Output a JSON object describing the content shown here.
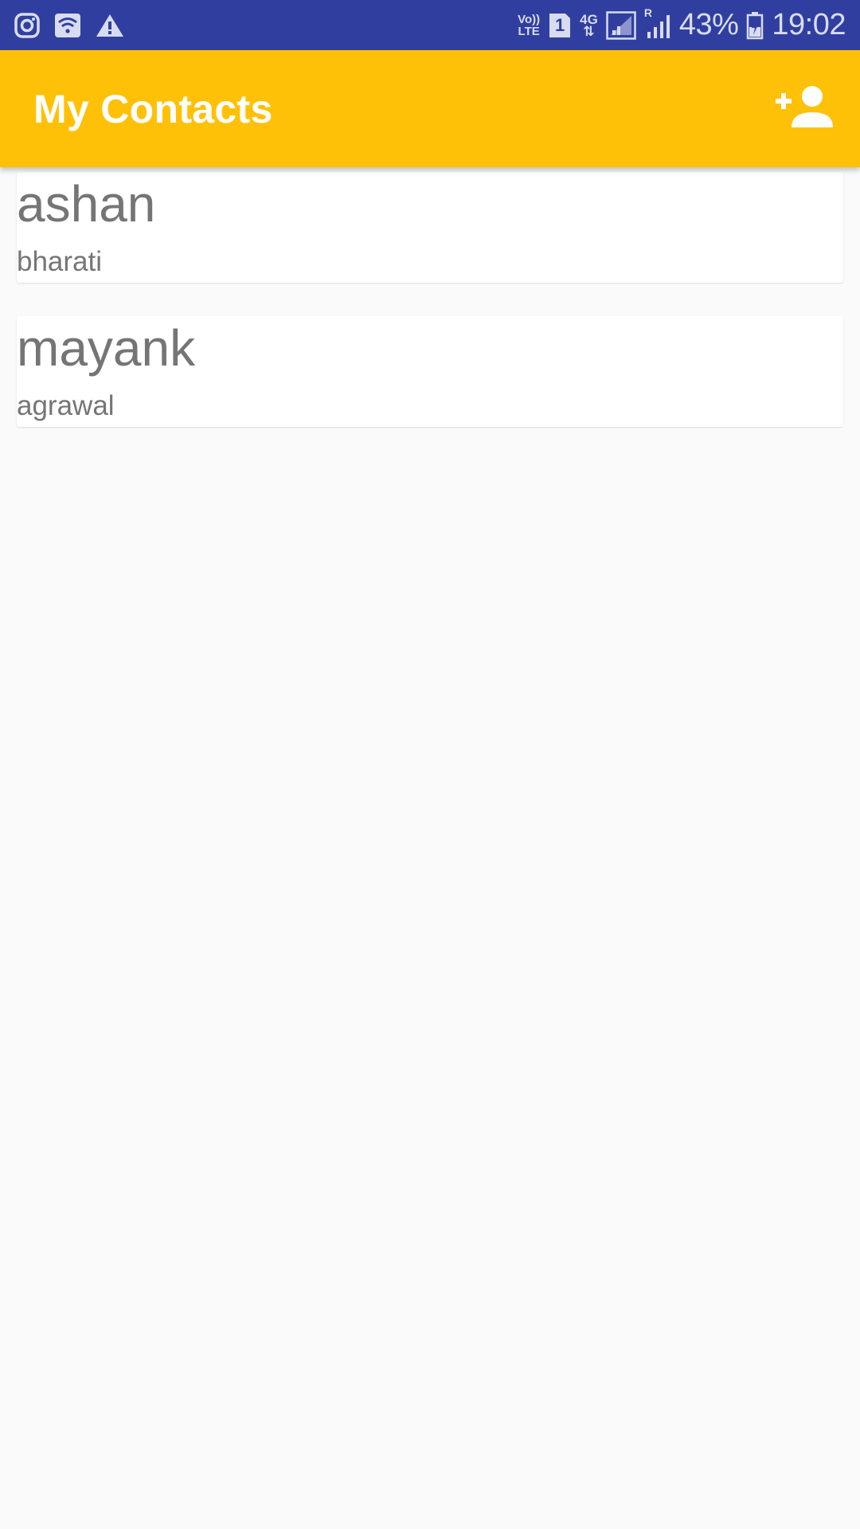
{
  "status_bar": {
    "left_icons": [
      "instagram-icon",
      "wifi-icon",
      "warning-icon"
    ],
    "volte_label_top": "Vo))",
    "volte_label_bottom": "LTE",
    "sim_badge": "1",
    "network_type": "4G",
    "roaming_label": "R",
    "battery_percent": "43%",
    "time": "19:02",
    "background_color": "#303f9f"
  },
  "app_bar": {
    "title": "My Contacts",
    "action_icon": "add-person-icon",
    "background_color": "#ffc107"
  },
  "contacts": [
    {
      "name": "ashan",
      "surname": "bharati"
    },
    {
      "name": "mayank",
      "surname": "agrawal"
    }
  ]
}
